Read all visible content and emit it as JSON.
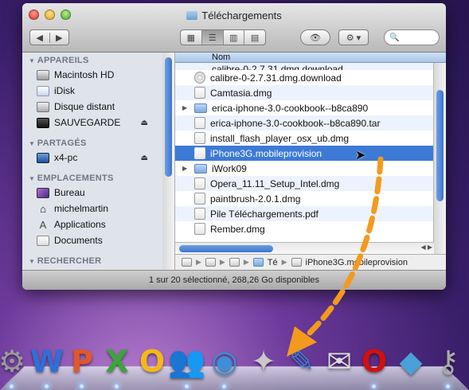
{
  "window": {
    "title": "Téléchargements",
    "status": "1 sur 20 sélectionné, 268,26 Go disponibles"
  },
  "toolbar": {
    "back": "◀",
    "forward": "▶",
    "view_icon": "▦",
    "view_list": "☰",
    "view_columns": "▥",
    "view_coverflow": "▤",
    "quicklook": "👁",
    "action": "⚙ ▾",
    "search_icon": "🔍"
  },
  "sidebar": {
    "devices_label": "APPAREILS",
    "devices": [
      {
        "label": "Macintosh HD"
      },
      {
        "label": "iDisk"
      },
      {
        "label": "Disque distant"
      },
      {
        "label": "SAUVEGARDE",
        "eject": "⏏"
      }
    ],
    "shared_label": "PARTAGÉS",
    "shared": [
      {
        "label": "x4-pc",
        "eject": "⏏"
      }
    ],
    "places_label": "EMPLACEMENTS",
    "places": [
      {
        "label": "Bureau"
      },
      {
        "label": "michelmartin"
      },
      {
        "label": "Applications"
      },
      {
        "label": "Documents"
      }
    ],
    "search_label": "RECHERCHER"
  },
  "list": {
    "column_name": "Nom",
    "rows": [
      {
        "name": "calibre-0-2.7.31.dmg.download"
      },
      {
        "name": "calibre-0-2.7.31.dmg.download"
      },
      {
        "name": "Camtasia.dmg"
      },
      {
        "name": "erica-iphone-3.0-cookbook--b8ca890"
      },
      {
        "name": "erica-iphone-3.0-cookbook--b8ca890.tar"
      },
      {
        "name": "install_flash_player_osx_ub.dmg"
      },
      {
        "name": "iPhone3G.mobileprovision"
      },
      {
        "name": "iWork09"
      },
      {
        "name": "Opera_11.11_Setup_Intel.dmg"
      },
      {
        "name": "paintbrush-2.0.1.dmg"
      },
      {
        "name": "Pile Téléchargements.pdf"
      },
      {
        "name": "Rember.dmg"
      }
    ]
  },
  "pathbar": {
    "folder": "Té",
    "file": "iPhone3G.mobileprovision"
  },
  "dock": {
    "items": [
      {
        "glyph": "⚙",
        "color": "#9a9a9a"
      },
      {
        "glyph": "W",
        "color": "#2f6fd6"
      },
      {
        "glyph": "P",
        "color": "#e0582a"
      },
      {
        "glyph": "X",
        "color": "#3aa53a"
      },
      {
        "glyph": "O",
        "color": "#f2b81a"
      },
      {
        "glyph": "👥",
        "color": "#49a0e0"
      },
      {
        "glyph": "◉",
        "color": "#3c8fd8"
      },
      {
        "glyph": "✦",
        "color": "#c9c9c9"
      },
      {
        "glyph": "✎",
        "color": "#3b7fd4"
      },
      {
        "glyph": "✉",
        "color": "#dcdcdc"
      },
      {
        "glyph": "O",
        "color": "#d01010"
      },
      {
        "glyph": "◆",
        "color": "#4aa0d8"
      },
      {
        "glyph": "⚷",
        "color": "#aaaaaa"
      }
    ]
  },
  "colors": {
    "selection": "#3d7ad6",
    "arrow": "#f39a1e"
  }
}
